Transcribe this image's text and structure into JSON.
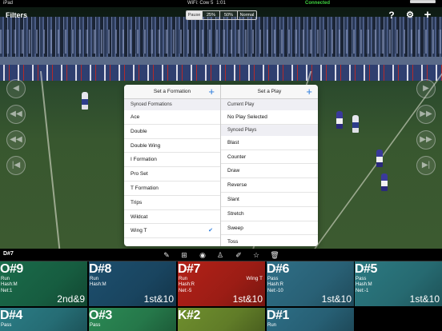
{
  "status_bar": {
    "device": "iPad",
    "wifi": "WiFi: Cow 5",
    "time": "1:01 AM",
    "connection": "Connected"
  },
  "topbar": {
    "filters_label": "Filters",
    "speed_options": [
      "Pause",
      "25%",
      "50%",
      "Normal"
    ],
    "speed_selected": "Pause",
    "help_label": "?",
    "settings_icon": "gear-icon",
    "add_label": "+"
  },
  "popover": {
    "left": {
      "title": "Set a Formation",
      "add_label": "+",
      "section": "Synced Formations",
      "items": [
        "Ace",
        "Double",
        "Double Wing",
        "I Formation",
        "Pro Set",
        "T Formation",
        "Trips",
        "Wildcat",
        "Wing T"
      ],
      "selected": "Wing T"
    },
    "right": {
      "title": "Set a Play",
      "add_label": "+",
      "current_section": "Current Play",
      "current_value": "No Play Selected",
      "synced_section": "Synced Plays",
      "items": [
        "Blast",
        "Counter",
        "Draw",
        "Reverse",
        "Slant",
        "Stretch",
        "Sweep",
        "Toss"
      ]
    }
  },
  "toolbar": {
    "clip_name": "D#7",
    "icons": [
      "edit-icon",
      "formation-icon",
      "football-icon",
      "players-icon",
      "pencil-icon",
      "star-icon",
      "trash-icon"
    ]
  },
  "clips": [
    {
      "num": "O#9",
      "type": "Run",
      "hash": "Hash:M",
      "net": "Net:1",
      "dd": "2nd&9",
      "color": "#1a6b4a"
    },
    {
      "num": "D#8",
      "type": "Run",
      "hash": "Hash:M",
      "net": "",
      "dd": "1st&10",
      "color": "#1d4f6e"
    },
    {
      "num": "D#7",
      "type": "Run",
      "hash": "Hash:R",
      "net": "Net:-5",
      "dd": "1st&10",
      "formation": "Wing T",
      "color": "#b32118"
    },
    {
      "num": "D#6",
      "type": "Pass",
      "hash": "Hash:R",
      "net": "Net:-10",
      "dd": "1st&10",
      "color": "#2f6f87"
    },
    {
      "num": "D#5",
      "type": "Pass",
      "hash": "Hash:M",
      "net": "Net:-1",
      "dd": "1st&10",
      "color": "#2c7a82"
    },
    {
      "num": "D#4",
      "type": "Pass",
      "color": "#2b7d86"
    },
    {
      "num": "O#3",
      "type": "Pass",
      "color": "#2b8a55"
    },
    {
      "num": "K#2",
      "type": "",
      "color": "#6f8f2e"
    },
    {
      "num": "D#1",
      "type": "Run",
      "color": "#2d6e86"
    }
  ]
}
